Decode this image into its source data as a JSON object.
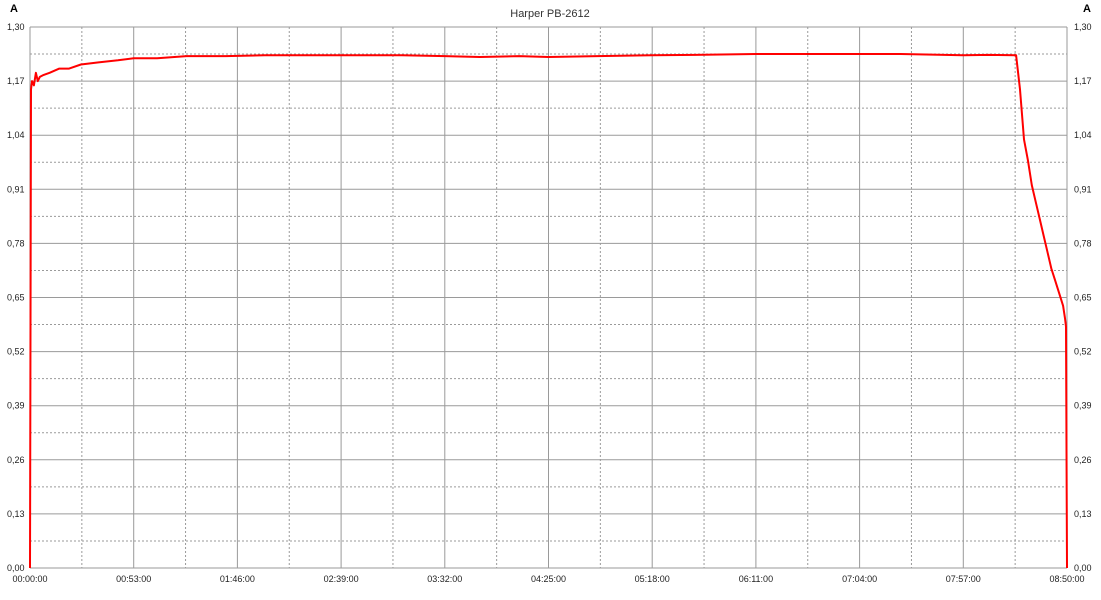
{
  "chart_data": {
    "type": "line",
    "title": "Harper PB-2612",
    "ylabel_left": "A",
    "ylabel_right": "A",
    "xlabel": "",
    "ylim": [
      0,
      1.3
    ],
    "xlim_minutes": [
      0,
      530
    ],
    "y_ticks": [
      "0,00",
      "0,13",
      "0,26",
      "0,39",
      "0,52",
      "0,65",
      "0,78",
      "0,91",
      "1,04",
      "1,17",
      "1,30"
    ],
    "x_ticks": [
      "00:00:00",
      "00:53:00",
      "01:46:00",
      "02:39:00",
      "03:32:00",
      "04:25:00",
      "05:18:00",
      "06:11:00",
      "07:04:00",
      "07:57:00",
      "08:50:00"
    ],
    "grid": "on",
    "line_color": "#ff0000",
    "series": [
      {
        "x_minutes": [
          0,
          0.5,
          1,
          2,
          3,
          4,
          5,
          7,
          10,
          15,
          20,
          26,
          35,
          45,
          53,
          65,
          80,
          90,
          100,
          120,
          140,
          159,
          175,
          190,
          212,
          230,
          250,
          265,
          290,
          318,
          340,
          371,
          390,
          410,
          424,
          445,
          477,
          490,
          504,
          506,
          508,
          510,
          512,
          514,
          516,
          518,
          520,
          522,
          524,
          526,
          528,
          529,
          529.5,
          530
        ],
        "y": [
          0.0,
          1.15,
          1.17,
          1.16,
          1.19,
          1.17,
          1.18,
          1.185,
          1.19,
          1.2,
          1.2,
          1.21,
          1.215,
          1.22,
          1.225,
          1.225,
          1.23,
          1.23,
          1.23,
          1.232,
          1.232,
          1.232,
          1.232,
          1.232,
          1.23,
          1.228,
          1.23,
          1.228,
          1.23,
          1.232,
          1.233,
          1.235,
          1.235,
          1.235,
          1.235,
          1.235,
          1.232,
          1.233,
          1.232,
          1.15,
          1.03,
          0.98,
          0.92,
          0.88,
          0.84,
          0.8,
          0.76,
          0.72,
          0.69,
          0.66,
          0.63,
          0.6,
          0.58,
          0.0
        ]
      }
    ]
  }
}
